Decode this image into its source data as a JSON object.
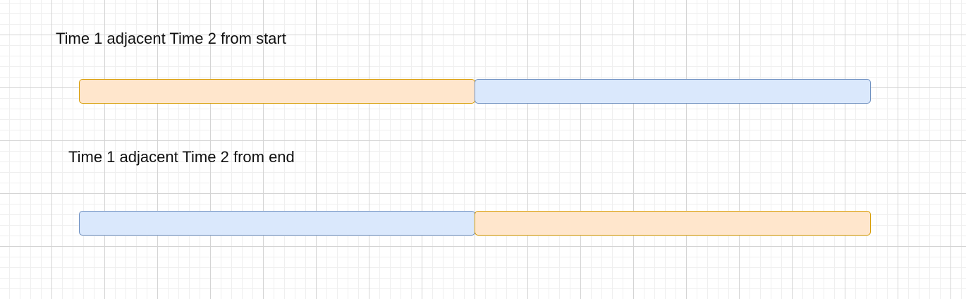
{
  "diagram": {
    "rows": [
      {
        "title": "Time 1 adjacent Time 2 from start",
        "segments": [
          {
            "style": "orange",
            "fill": "#ffe6cc",
            "stroke": "#d79b00"
          },
          {
            "style": "blue",
            "fill": "#dae8fc",
            "stroke": "#6c8ebf"
          }
        ]
      },
      {
        "title": "Time 1 adjacent Time 2 from end",
        "segments": [
          {
            "style": "blue",
            "fill": "#dae8fc",
            "stroke": "#6c8ebf"
          },
          {
            "style": "orange",
            "fill": "#ffe6cc",
            "stroke": "#d79b00"
          }
        ]
      }
    ],
    "background": "grid"
  }
}
